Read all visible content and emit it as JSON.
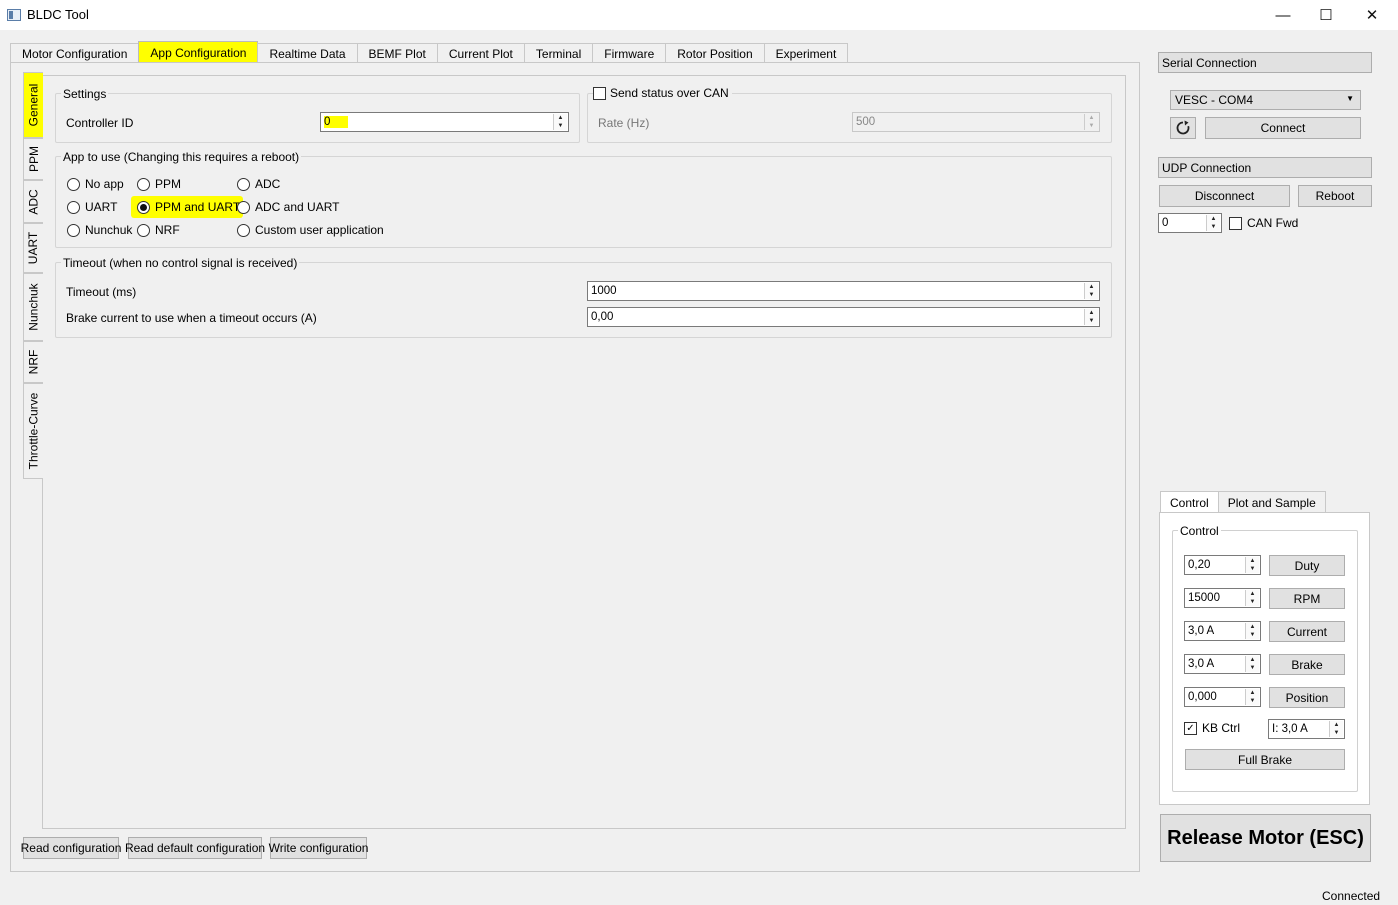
{
  "window": {
    "title": "BLDC Tool",
    "minimize": "—",
    "maximize": "☐",
    "close": "✕"
  },
  "top_tabs": [
    "Motor Configuration",
    "App Configuration",
    "Realtime Data",
    "BEMF Plot",
    "Current Plot",
    "Terminal",
    "Firmware",
    "Rotor Position",
    "Experiment"
  ],
  "side_tabs": [
    "General",
    "PPM",
    "ADC",
    "UART",
    "Nunchuk",
    "NRF",
    "Throttle-Curve"
  ],
  "settings": {
    "title": "Settings",
    "controller_id_label": "Controller ID",
    "controller_id": "0"
  },
  "can": {
    "title": "Send status over CAN",
    "rate_label": "Rate (Hz)",
    "rate": "500"
  },
  "app": {
    "title": "App to use (Changing this requires a reboot)",
    "options": [
      "No app",
      "PPM",
      "ADC",
      "UART",
      "PPM and UART",
      "ADC and UART",
      "Nunchuk",
      "NRF",
      "Custom user application"
    ],
    "selected": "PPM and UART"
  },
  "timeout": {
    "title": "Timeout (when no control signal is received)",
    "timeout_label": "Timeout (ms)",
    "timeout_value": "1000",
    "brake_label": "Brake current to use when a timeout occurs (A)",
    "brake_value": "0,00"
  },
  "bottom_buttons": {
    "read": "Read configuration",
    "read_default": "Read default configuration",
    "write": "Write configuration"
  },
  "serial": {
    "header": "Serial Connection",
    "port": "VESC - COM4",
    "refresh_icon": "refresh-icon",
    "connect": "Connect"
  },
  "udp": {
    "header": "UDP Connection",
    "disconnect": "Disconnect",
    "reboot": "Reboot",
    "can_id": "0",
    "can_fwd": "CAN Fwd"
  },
  "control_tabs": [
    "Control",
    "Plot and Sample"
  ],
  "control": {
    "title": "Control",
    "duty_value": "0,20",
    "duty_btn": "Duty",
    "rpm_value": "15000",
    "rpm_btn": "RPM",
    "current_value": "3,0 A",
    "current_btn": "Current",
    "brake_value": "3,0 A",
    "brake_btn": "Brake",
    "position_value": "0,000",
    "position_btn": "Position",
    "kb_ctrl": "KB Ctrl",
    "kb_current": "I: 3,0 A",
    "full_brake": "Full Brake"
  },
  "release": "Release Motor (ESC)",
  "status": "Connected",
  "colors": {
    "highlight": "#ffff00",
    "background": "#f0f0f0"
  }
}
